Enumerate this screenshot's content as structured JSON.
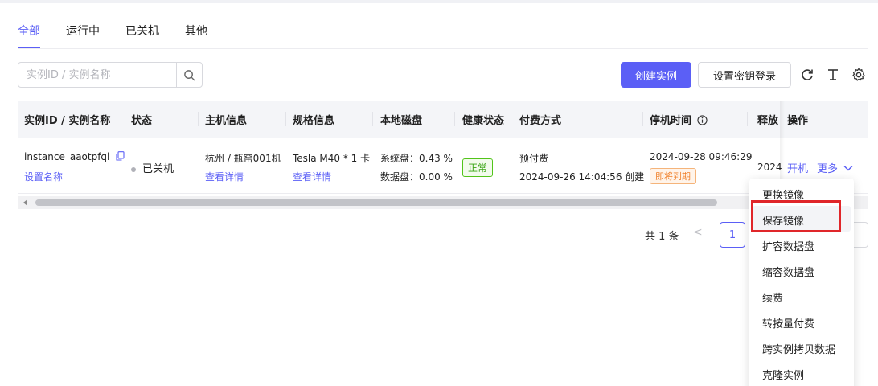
{
  "tabs": [
    {
      "label": "全部",
      "active": true
    },
    {
      "label": "运行中",
      "active": false
    },
    {
      "label": "已关机",
      "active": false
    },
    {
      "label": "其他",
      "active": false
    }
  ],
  "toolbar": {
    "search_placeholder": "实例ID / 实例名称",
    "create_button": "创建实例",
    "ssh_key_button": "设置密钥登录"
  },
  "table": {
    "columns": [
      "实例ID / 实例名称",
      "状态",
      "主机信息",
      "规格信息",
      "本地磁盘",
      "健康状态",
      "付费方式",
      "停机时间",
      "释放",
      "操作"
    ],
    "row": {
      "instance_id": "instance_aaotpfql",
      "rename_link": "设置名称",
      "status": "已关机",
      "host": "杭州 / 瓶窑001机",
      "host_detail_link": "查看详情",
      "spec": "Tesla M40 * 1 卡",
      "spec_detail_link": "查看详情",
      "disk_system": "系统盘：0.43 %",
      "disk_data": "数据盘：0.00 %",
      "health": "正常",
      "billing_type": "预付费",
      "billing_created": "2024-09-26 14:04:56 创建",
      "stop_time": "2024-09-28 09:46:29",
      "stop_tag": "即将到期",
      "release": "2024",
      "action_start": "开机",
      "action_more": "更多"
    }
  },
  "pagination": {
    "total": "共 1 条",
    "prev": "<",
    "current_page": "1"
  },
  "dropdown": {
    "items": [
      "更换镜像",
      "保存镜像",
      "扩容数据盘",
      "缩容数据盘",
      "续费",
      "转按量付费",
      "跨实例拷贝数据",
      "克隆实例"
    ],
    "hovered_index": 1
  },
  "colors": {
    "accent": "#5b5ff6",
    "highlight": "#e0262a",
    "health_green": "#52c41a",
    "warn_orange": "#f0802a"
  }
}
